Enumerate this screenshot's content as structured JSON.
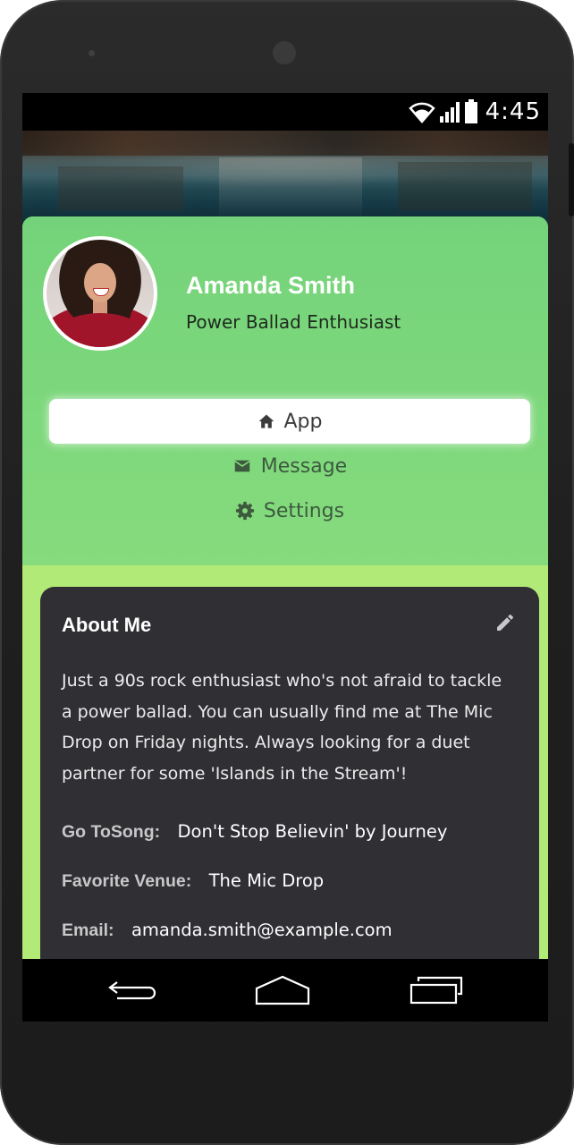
{
  "status_bar": {
    "time": "4:45",
    "icons": [
      "wifi-icon",
      "signal-icon",
      "battery-icon"
    ]
  },
  "profile": {
    "name": "Amanda Smith",
    "tagline": "Power Ballad Enthusiast"
  },
  "menu": {
    "items": [
      {
        "label": "App",
        "icon": "home-icon",
        "active": true
      },
      {
        "label": "Message",
        "icon": "mail-icon",
        "active": false
      },
      {
        "label": "Settings",
        "icon": "gear-icon",
        "active": false
      }
    ]
  },
  "about": {
    "title": "About Me",
    "bio_lines": [
      "Just a 90s rock enthusiast who's not afraid to tackle",
      "a power ballad. You can usually find me at The Mic",
      "Drop on Friday nights. Always looking for a duet",
      "partner for some 'Islands in the Stream'!"
    ],
    "fields": [
      {
        "label": "Go ToSong:",
        "value": "Don't Stop Believin' by Journey"
      },
      {
        "label": "Favorite Venue:",
        "value": "The Mic Drop"
      },
      {
        "label": "Email:",
        "value": "amanda.smith@example.com"
      }
    ]
  },
  "nav_bar": {
    "buttons": [
      "back-icon",
      "home-outline-icon",
      "recents-icon"
    ]
  },
  "colors": {
    "header_green": "#7ed87c",
    "content_green": "#b2ea78",
    "card_bg": "#2f2f34",
    "phone_body": "#222222"
  }
}
